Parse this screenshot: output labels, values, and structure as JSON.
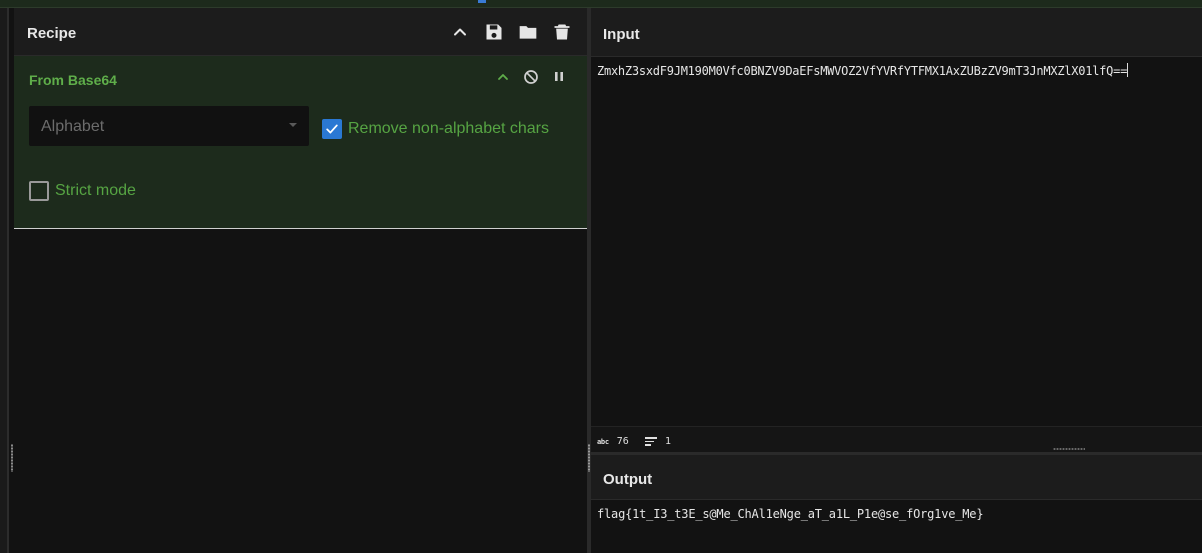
{
  "recipe": {
    "title": "Recipe",
    "operation": {
      "name": "From Base64",
      "alphabet_label": "Alphabet",
      "remove_non_alphabet_label": "Remove non-alphabet chars",
      "remove_non_alphabet_checked": true,
      "strict_mode_label": "Strict mode",
      "strict_mode_checked": false
    }
  },
  "input": {
    "title": "Input",
    "text": "ZmxhZ3sxdF9JM190M0Vfc0BNZV9DaEFsMWVOZ2VfYVRfYTFMX1AxZUBzZV9mT3JnMXZlX01lfQ==",
    "status": {
      "length": "76",
      "lines": "1"
    }
  },
  "output": {
    "title": "Output",
    "text": "flag{1t_I3_t3E_s@Me_ChAl1eNge_aT_a1L_P1e@se_fOrg1ve_Me}"
  },
  "colors": {
    "accent": "#5fae4a",
    "operation_bg": "#1d2b1c",
    "checkbox_on": "#2a78d3"
  },
  "icons": {
    "header": [
      "chevron-up-icon",
      "save-icon",
      "folder-icon",
      "trash-icon"
    ],
    "operation": [
      "chevron-up-icon",
      "disable-icon",
      "pause-icon"
    ]
  }
}
